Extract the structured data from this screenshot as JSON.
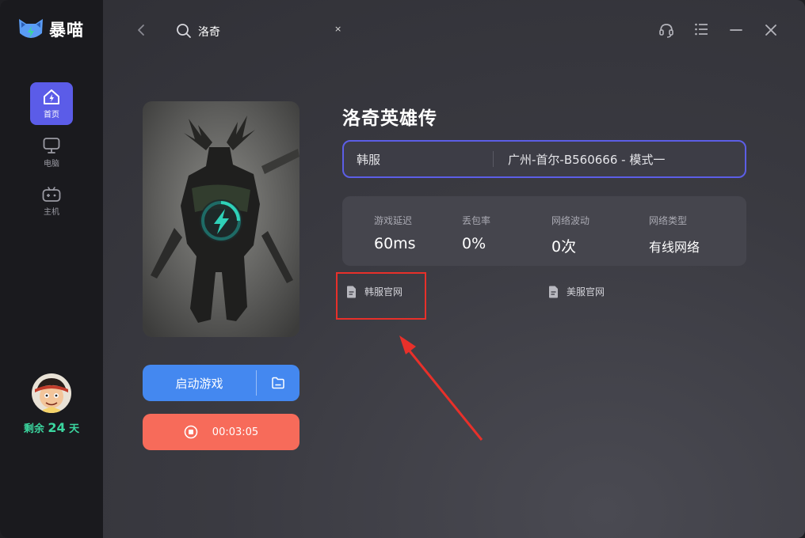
{
  "app": {
    "name": "暴喵"
  },
  "sidebar": {
    "items": [
      {
        "label": "首页",
        "icon": "home-icon",
        "active": true
      },
      {
        "label": "电脑",
        "icon": "monitor-icon",
        "active": false
      },
      {
        "label": "主机",
        "icon": "gamepad-icon",
        "active": false
      }
    ],
    "remaining_prefix": "剩余",
    "remaining_days": "24",
    "remaining_suffix": "天"
  },
  "topbar": {
    "search_query": "洛奇",
    "clear_symbol": "×"
  },
  "game": {
    "title": "洛奇英雄传",
    "region": "韩服",
    "node": "广州-首尔-B560666 - 模式一",
    "start_label": "启动游戏",
    "timer": "00:03:05"
  },
  "stats": [
    {
      "label": "游戏延迟",
      "value": "60ms"
    },
    {
      "label": "丢包率",
      "value": "0%"
    },
    {
      "label": "网络波动",
      "value": "0次"
    },
    {
      "label": "网络类型",
      "value": "有线网络"
    }
  ],
  "links": [
    {
      "label": "韩服官网"
    },
    {
      "label": "美服官网"
    }
  ],
  "colors": {
    "accent": "#5b5ce8",
    "start_button": "#4488f0",
    "stop_button": "#f76b5a",
    "remaining_text": "#3bd69f",
    "annotation_red": "#e8302a"
  }
}
